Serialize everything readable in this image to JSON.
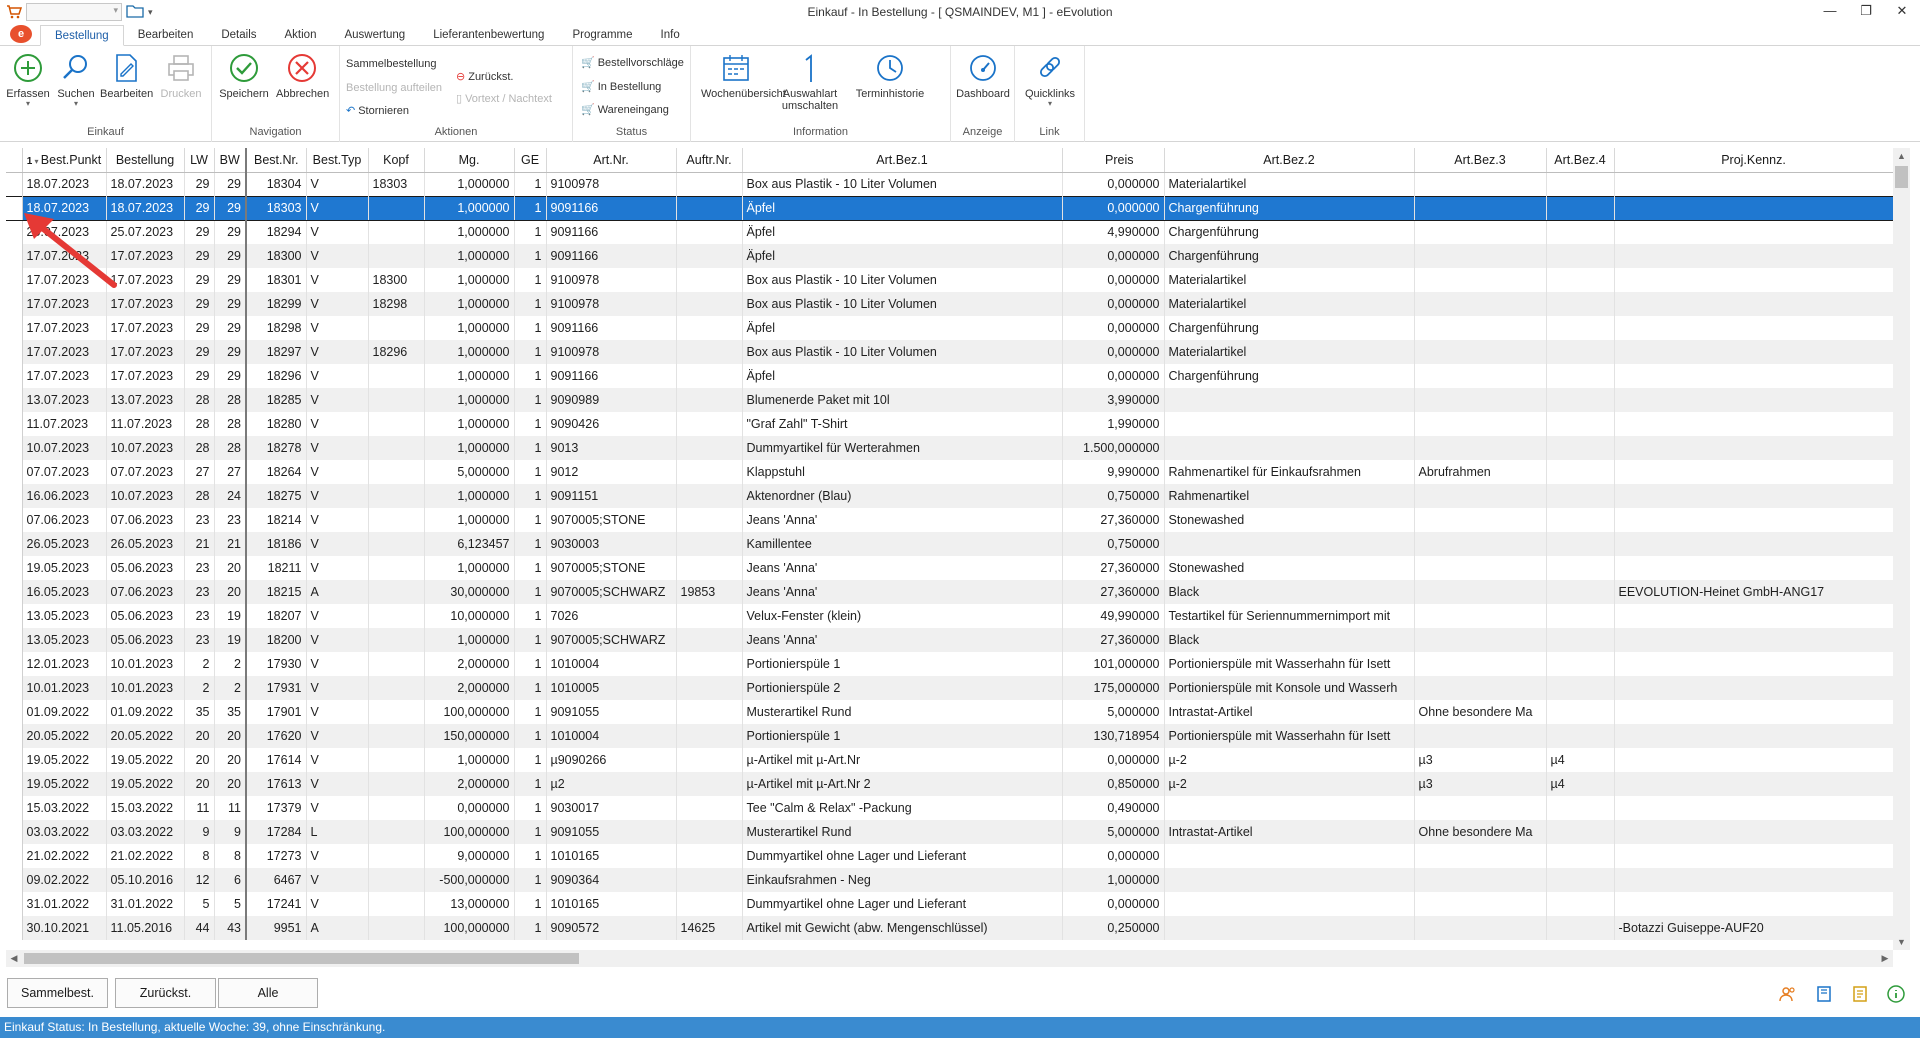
{
  "window": {
    "title": "Einkauf - In Bestellung - [ QSMAINDEV, M1 ]  -  eEvolution",
    "minimize": "—",
    "maximize": "❐",
    "close": "✕"
  },
  "menu_tabs": [
    "Bestellung",
    "Bearbeiten",
    "Details",
    "Aktion",
    "Auswertung",
    "Lieferantenbewertung",
    "Programme",
    "Info"
  ],
  "ribbon": {
    "einkauf": {
      "label": "Einkauf",
      "erfassen": "Erfassen",
      "suchen": "Suchen",
      "bearbeiten": "Bearbeiten",
      "drucken": "Drucken"
    },
    "navigation": {
      "label": "Navigation",
      "speichern": "Speichern",
      "abbrechen": "Abbrechen"
    },
    "aktionen": {
      "label": "Aktionen",
      "sammelbestellung": "Sammelbestellung",
      "bestellung_aufteilen": "Bestellung aufteilen",
      "stornieren": "Stornieren",
      "zurueckst": "Zurückst.",
      "vortext_nachtext": "Vortext / Nachtext"
    },
    "status": {
      "label": "Status",
      "bestellvorschlaege": "Bestellvorschläge",
      "in_bestellung": "In Bestellung",
      "wareneingang": "Wareneingang"
    },
    "information": {
      "label": "Information",
      "wochenuebersicht": "Wochenübersicht",
      "auswahlart_1": "Auswahlart",
      "auswahlart_2": "umschalten",
      "terminhistorie": "Terminhistorie"
    },
    "anzeige": {
      "label": "Anzeige",
      "dashboard": "Dashboard"
    },
    "link": {
      "label": "Link",
      "quicklinks": "Quicklinks"
    }
  },
  "grid": {
    "sort_indicator": "1",
    "columns": [
      "Best.Punkt",
      "Bestellung",
      "LW",
      "BW",
      "Best.Nr.",
      "Best.Typ",
      "Kopf",
      "Mg.",
      "GE",
      "Art.Nr.",
      "Auftr.Nr.",
      "Art.Bez.1",
      "Preis",
      "Art.Bez.2",
      "Art.Bez.3",
      "Art.Bez.4",
      "Proj.Kennz."
    ],
    "selected_marker": "×",
    "rows": [
      [
        "18.07.2023",
        "18.07.2023",
        "29",
        "29",
        "18304",
        "V",
        "18303",
        "1,000000",
        "1",
        "9100978",
        "",
        "Box aus Plastik - 10 Liter Volumen",
        "0,000000",
        "Materialartikel",
        "",
        "",
        ""
      ],
      [
        "18.07.2023",
        "18.07.2023",
        "29",
        "29",
        "18303",
        "V",
        "",
        "1,000000",
        "1",
        "9091166",
        "",
        "Äpfel",
        "0,000000",
        "Chargenführung",
        "",
        "",
        ""
      ],
      [
        "25.07.2023",
        "25.07.2023",
        "29",
        "29",
        "18294",
        "V",
        "",
        "1,000000",
        "1",
        "9091166",
        "",
        "Äpfel",
        "4,990000",
        "Chargenführung",
        "",
        "",
        ""
      ],
      [
        "17.07.2023",
        "17.07.2023",
        "29",
        "29",
        "18300",
        "V",
        "",
        "1,000000",
        "1",
        "9091166",
        "",
        "Äpfel",
        "0,000000",
        "Chargenführung",
        "",
        "",
        ""
      ],
      [
        "17.07.2023",
        "17.07.2023",
        "29",
        "29",
        "18301",
        "V",
        "18300",
        "1,000000",
        "1",
        "9100978",
        "",
        "Box aus Plastik - 10 Liter Volumen",
        "0,000000",
        "Materialartikel",
        "",
        "",
        ""
      ],
      [
        "17.07.2023",
        "17.07.2023",
        "29",
        "29",
        "18299",
        "V",
        "18298",
        "1,000000",
        "1",
        "9100978",
        "",
        "Box aus Plastik - 10 Liter Volumen",
        "0,000000",
        "Materialartikel",
        "",
        "",
        ""
      ],
      [
        "17.07.2023",
        "17.07.2023",
        "29",
        "29",
        "18298",
        "V",
        "",
        "1,000000",
        "1",
        "9091166",
        "",
        "Äpfel",
        "0,000000",
        "Chargenführung",
        "",
        "",
        ""
      ],
      [
        "17.07.2023",
        "17.07.2023",
        "29",
        "29",
        "18297",
        "V",
        "18296",
        "1,000000",
        "1",
        "9100978",
        "",
        "Box aus Plastik - 10 Liter Volumen",
        "0,000000",
        "Materialartikel",
        "",
        "",
        ""
      ],
      [
        "17.07.2023",
        "17.07.2023",
        "29",
        "29",
        "18296",
        "V",
        "",
        "1,000000",
        "1",
        "9091166",
        "",
        "Äpfel",
        "0,000000",
        "Chargenführung",
        "",
        "",
        ""
      ],
      [
        "13.07.2023",
        "13.07.2023",
        "28",
        "28",
        "18285",
        "V",
        "",
        "1,000000",
        "1",
        "9090989",
        "",
        "Blumenerde Paket mit 10l",
        "3,990000",
        "",
        "",
        "",
        ""
      ],
      [
        "11.07.2023",
        "11.07.2023",
        "28",
        "28",
        "18280",
        "V",
        "",
        "1,000000",
        "1",
        "9090426",
        "",
        "\"Graf Zahl\" T-Shirt",
        "1,990000",
        "",
        "",
        "",
        ""
      ],
      [
        "10.07.2023",
        "10.07.2023",
        "28",
        "28",
        "18278",
        "V",
        "",
        "1,000000",
        "1",
        "9013",
        "",
        "Dummyartikel für Werterahmen",
        "1.500,000000",
        "",
        "",
        "",
        ""
      ],
      [
        "07.07.2023",
        "07.07.2023",
        "27",
        "27",
        "18264",
        "V",
        "",
        "5,000000",
        "1",
        "9012",
        "",
        "Klappstuhl",
        "9,990000",
        "Rahmenartikel für Einkaufsrahmen",
        "Abrufrahmen",
        "",
        ""
      ],
      [
        "16.06.2023",
        "10.07.2023",
        "28",
        "24",
        "18275",
        "V",
        "",
        "1,000000",
        "1",
        "9091151",
        "",
        "Aktenordner (Blau)",
        "0,750000",
        "Rahmenartikel",
        "",
        "",
        ""
      ],
      [
        "07.06.2023",
        "07.06.2023",
        "23",
        "23",
        "18214",
        "V",
        "",
        "1,000000",
        "1",
        "9070005;STONE",
        "",
        "Jeans 'Anna'",
        "27,360000",
        "Stonewashed",
        "",
        "",
        ""
      ],
      [
        "26.05.2023",
        "26.05.2023",
        "21",
        "21",
        "18186",
        "V",
        "",
        "6,123457",
        "1",
        "9030003",
        "",
        "Kamillentee",
        "0,750000",
        "",
        "",
        "",
        ""
      ],
      [
        "19.05.2023",
        "05.06.2023",
        "23",
        "20",
        "18211",
        "V",
        "",
        "1,000000",
        "1",
        "9070005;STONE",
        "",
        "Jeans 'Anna'",
        "27,360000",
        "Stonewashed",
        "",
        "",
        ""
      ],
      [
        "16.05.2023",
        "07.06.2023",
        "23",
        "20",
        "18215",
        "A",
        "",
        "30,000000",
        "1",
        "9070005;SCHWARZ",
        "19853",
        "Jeans 'Anna'",
        "27,360000",
        "Black",
        "",
        "",
        "EEVOLUTION-Heinet GmbH-ANG17"
      ],
      [
        "13.05.2023",
        "05.06.2023",
        "23",
        "19",
        "18207",
        "V",
        "",
        "10,000000",
        "1",
        "7026",
        "",
        "Velux-Fenster (klein)",
        "49,990000",
        "Testartikel für Seriennummernimport mit",
        "",
        "",
        ""
      ],
      [
        "13.05.2023",
        "05.06.2023",
        "23",
        "19",
        "18200",
        "V",
        "",
        "1,000000",
        "1",
        "9070005;SCHWARZ",
        "",
        "Jeans 'Anna'",
        "27,360000",
        "Black",
        "",
        "",
        ""
      ],
      [
        "12.01.2023",
        "10.01.2023",
        "2",
        "2",
        "17930",
        "V",
        "",
        "2,000000",
        "1",
        "1010004",
        "",
        "Portionierspüle 1",
        "101,000000",
        "Portionierspüle mit Wasserhahn für Isett",
        "",
        "",
        ""
      ],
      [
        "10.01.2023",
        "10.01.2023",
        "2",
        "2",
        "17931",
        "V",
        "",
        "2,000000",
        "1",
        "1010005",
        "",
        "Portionierspüle 2",
        "175,000000",
        "Portionierspüle mit Konsole und Wasserh",
        "",
        "",
        ""
      ],
      [
        "01.09.2022",
        "01.09.2022",
        "35",
        "35",
        "17901",
        "V",
        "",
        "100,000000",
        "1",
        "9091055",
        "",
        "Musterartikel Rund",
        "5,000000",
        "Intrastat-Artikel",
        "Ohne besondere Ma",
        "",
        ""
      ],
      [
        "20.05.2022",
        "20.05.2022",
        "20",
        "20",
        "17620",
        "V",
        "",
        "150,000000",
        "1",
        "1010004",
        "",
        "Portionierspüle 1",
        "130,718954",
        "Portionierspüle mit Wasserhahn für Isett",
        "",
        "",
        ""
      ],
      [
        "19.05.2022",
        "19.05.2022",
        "20",
        "20",
        "17614",
        "V",
        "",
        "1,000000",
        "1",
        "µ9090266",
        "",
        "µ-Artikel mit µ-Art.Nr",
        "0,000000",
        "µ-2",
        "µ3",
        "µ4",
        ""
      ],
      [
        "19.05.2022",
        "19.05.2022",
        "20",
        "20",
        "17613",
        "V",
        "",
        "2,000000",
        "1",
        "µ2",
        "",
        "µ-Artikel mit µ-Art.Nr 2",
        "0,850000",
        "µ-2",
        "µ3",
        "µ4",
        ""
      ],
      [
        "15.03.2022",
        "15.03.2022",
        "11",
        "11",
        "17379",
        "V",
        "",
        "0,000000",
        "1",
        "9030017",
        "",
        "Tee \"Calm & Relax\" -Packung",
        "0,490000",
        "",
        "",
        "",
        ""
      ],
      [
        "03.03.2022",
        "03.03.2022",
        "9",
        "9",
        "17284",
        "L",
        "",
        "100,000000",
        "1",
        "9091055",
        "",
        "Musterartikel Rund",
        "5,000000",
        "Intrastat-Artikel",
        "Ohne besondere Ma",
        "",
        ""
      ],
      [
        "21.02.2022",
        "21.02.2022",
        "8",
        "8",
        "17273",
        "V",
        "",
        "9,000000",
        "1",
        "1010165",
        "",
        "Dummyartikel ohne Lager und Lieferant",
        "0,000000",
        "",
        "",
        "",
        ""
      ],
      [
        "09.02.2022",
        "05.10.2016",
        "12",
        "6",
        "6467",
        "V",
        "",
        "-500,000000",
        "1",
        "9090364",
        "",
        "Einkaufsrahmen - Neg",
        "1,000000",
        "",
        "",
        "",
        ""
      ],
      [
        "31.01.2022",
        "31.01.2022",
        "5",
        "5",
        "17241",
        "V",
        "",
        "13,000000",
        "1",
        "1010165",
        "",
        "Dummyartikel ohne Lager und Lieferant",
        "0,000000",
        "",
        "",
        "",
        ""
      ],
      [
        "30.10.2021",
        "11.05.2016",
        "44",
        "43",
        "9951",
        "A",
        "",
        "100,000000",
        "1",
        "9090572",
        "14625",
        "Artikel mit Gewicht (abw. Mengenschlüssel)",
        "0,250000",
        "",
        "",
        "",
        "-Botazzi Guiseppe-AUF20"
      ]
    ]
  },
  "bottom_buttons": [
    "Sammelbest.",
    "Zurückst.",
    "Alle"
  ],
  "status": "Einkauf Status: In Bestellung, aktuelle Woche: 39, ohne Einschränkung.",
  "colors": {
    "selection": "#1f78d1",
    "statusbar": "#3a8bd0",
    "accent_tab": "#1e5fa8",
    "arrow": "#e53935"
  }
}
